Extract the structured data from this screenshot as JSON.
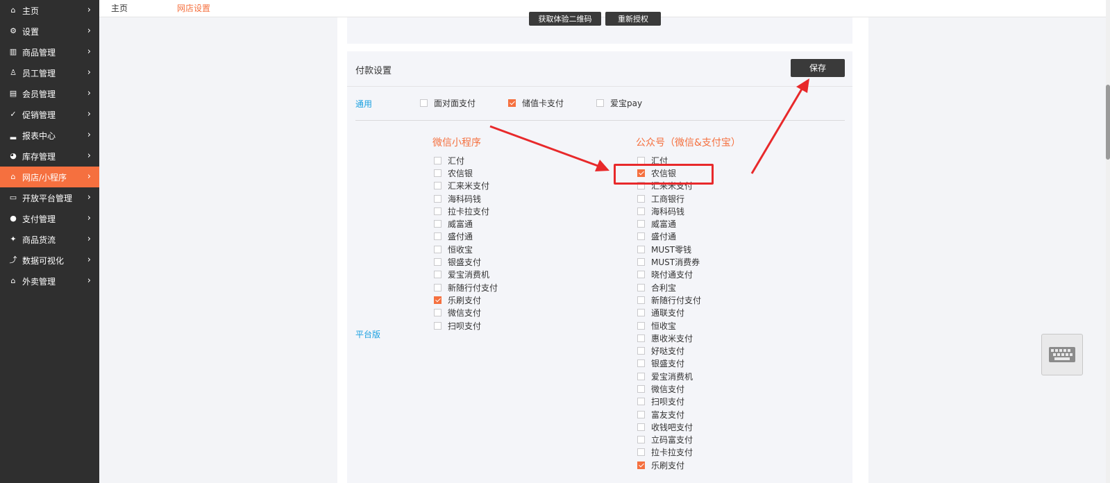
{
  "sidebar": {
    "items": [
      {
        "label": "主页",
        "icon": "home-icon",
        "glyph": "⌂"
      },
      {
        "label": "设置",
        "icon": "gear-icon",
        "glyph": "⚙"
      },
      {
        "label": "商品管理",
        "icon": "barcode-icon",
        "glyph": "▥"
      },
      {
        "label": "员工管理",
        "icon": "user-icon",
        "glyph": "♙"
      },
      {
        "label": "会员管理",
        "icon": "member-card-icon",
        "glyph": "▤"
      },
      {
        "label": "促销管理",
        "icon": "check-circle-icon",
        "glyph": "✓"
      },
      {
        "label": "报表中心",
        "icon": "bar-chart-icon",
        "glyph": "▂"
      },
      {
        "label": "库存管理",
        "icon": "pie-chart-icon",
        "glyph": "◕"
      },
      {
        "label": "网店/小程序",
        "icon": "store-icon",
        "glyph": "⌂",
        "active": true
      },
      {
        "label": "开放平台管理",
        "icon": "monitor-icon",
        "glyph": "▭"
      },
      {
        "label": "支付管理",
        "icon": "payment-icon",
        "glyph": "●"
      },
      {
        "label": "商品货流",
        "icon": "box-icon",
        "glyph": "✦"
      },
      {
        "label": "数据可视化",
        "icon": "line-chart-icon",
        "glyph": "⤴"
      },
      {
        "label": "外卖管理",
        "icon": "takeout-store-icon",
        "glyph": "⌂"
      }
    ],
    "chevron": "›"
  },
  "breadcrumb": {
    "home": "主页",
    "current": "网店设置"
  },
  "top_buttons": {
    "a": "获取体验二维码",
    "b": "重新授权"
  },
  "payment": {
    "title": "付款设置",
    "save": "保存",
    "general_label": "通用",
    "platform_label": "平台版",
    "general_options": [
      {
        "label": "面对面支付",
        "checked": false
      },
      {
        "label": "储值卡支付",
        "checked": true
      },
      {
        "label": "爱宝pay",
        "checked": false
      }
    ],
    "mini_program": {
      "title": "微信小程序",
      "options": [
        {
          "label": "汇付",
          "checked": false
        },
        {
          "label": "农信银",
          "checked": false
        },
        {
          "label": "汇来米支付",
          "checked": false
        },
        {
          "label": "海科码钱",
          "checked": false
        },
        {
          "label": "拉卡拉支付",
          "checked": false
        },
        {
          "label": "威富通",
          "checked": false
        },
        {
          "label": "盛付通",
          "checked": false
        },
        {
          "label": "恒收宝",
          "checked": false
        },
        {
          "label": "银盛支付",
          "checked": false
        },
        {
          "label": "爱宝消费机",
          "checked": false
        },
        {
          "label": "新随行付支付",
          "checked": false
        },
        {
          "label": "乐刷支付",
          "checked": true
        },
        {
          "label": "微信支付",
          "checked": false
        },
        {
          "label": "扫呗支付",
          "checked": false
        }
      ]
    },
    "public_account": {
      "title": "公众号（微信&支付宝）",
      "options": [
        {
          "label": "汇付",
          "checked": false
        },
        {
          "label": "农信银",
          "checked": true
        },
        {
          "label": "汇来米支付",
          "checked": false
        },
        {
          "label": "工商银行",
          "checked": false
        },
        {
          "label": "海科码钱",
          "checked": false
        },
        {
          "label": "威富通",
          "checked": false
        },
        {
          "label": "盛付通",
          "checked": false
        },
        {
          "label": "MUST零钱",
          "checked": false
        },
        {
          "label": "MUST消费券",
          "checked": false
        },
        {
          "label": "晓付通支付",
          "checked": false
        },
        {
          "label": "合利宝",
          "checked": false
        },
        {
          "label": "新随行付支付",
          "checked": false
        },
        {
          "label": "通联支付",
          "checked": false
        },
        {
          "label": "恒收宝",
          "checked": false
        },
        {
          "label": "惠收米支付",
          "checked": false
        },
        {
          "label": "好哒支付",
          "checked": false
        },
        {
          "label": "银盛支付",
          "checked": false
        },
        {
          "label": "爱宝消费机",
          "checked": false
        },
        {
          "label": "微信支付",
          "checked": false
        },
        {
          "label": "扫呗支付",
          "checked": false
        },
        {
          "label": "富友支付",
          "checked": false
        },
        {
          "label": "收钱吧支付",
          "checked": false
        },
        {
          "label": "立码富支付",
          "checked": false
        },
        {
          "label": "拉卡拉支付",
          "checked": false
        },
        {
          "label": "乐刷支付",
          "checked": true
        }
      ]
    }
  },
  "colors": {
    "accent": "#f5703f",
    "link": "#1aa0e0",
    "annotation": "#e8292b",
    "sidebar_bg": "#2f2f2f"
  }
}
